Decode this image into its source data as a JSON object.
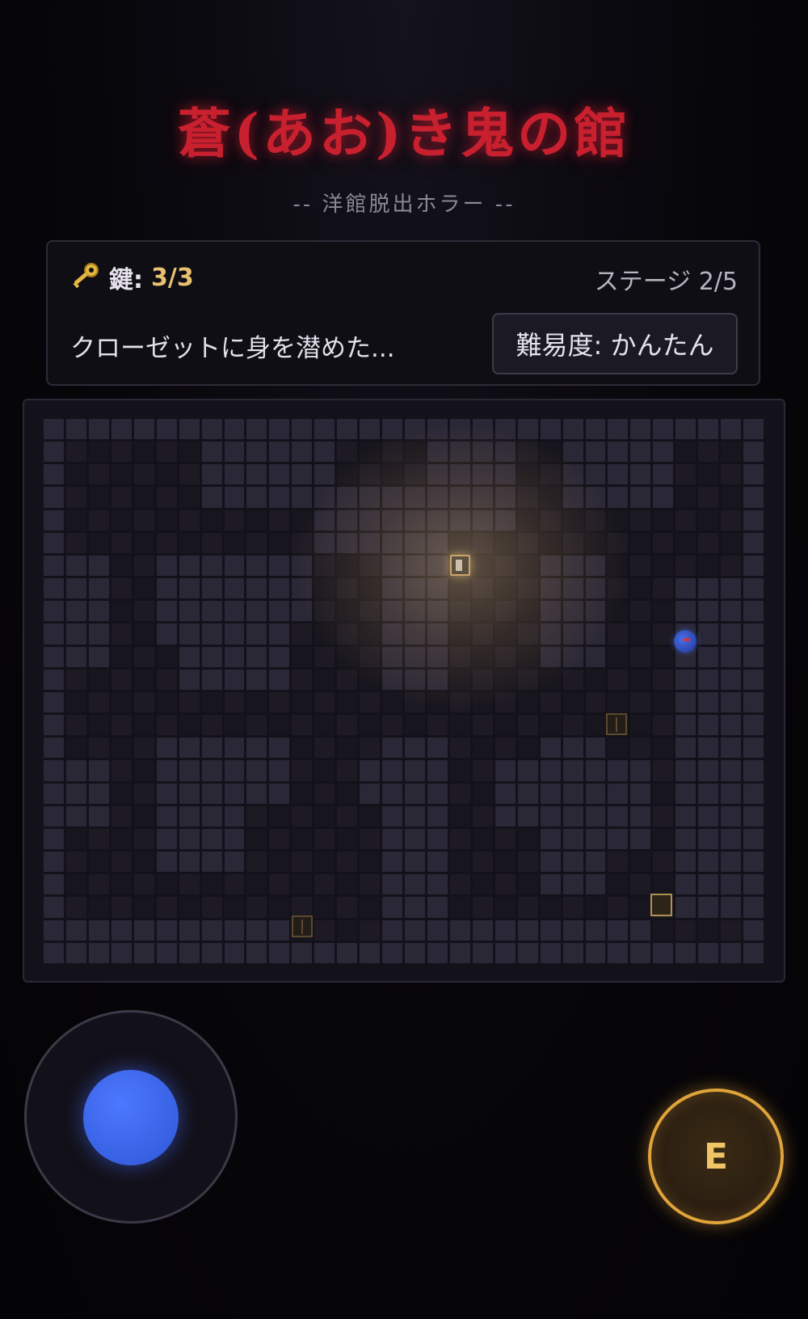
{
  "header": {
    "title": "蒼(あお)き鬼の館",
    "subtitle": "-- 洋館脱出ホラー --"
  },
  "status": {
    "keys_label": "鍵:",
    "keys_count": "3/3",
    "stage": "ステージ 2/5",
    "message": "クローゼットに身を潜めた...",
    "difficulty": "難易度: かんたん"
  },
  "controls": {
    "action_label": "E"
  },
  "colors": {
    "title": "#c8202e",
    "key_count": "#e8c170",
    "joystick": "#3a66f0",
    "action_ring": "#e0a53a"
  },
  "icons": {
    "keys": "key-icon",
    "ghost": "blue-oni-icon",
    "player": "player-icon",
    "closet": "closet-icon",
    "exit": "exit-door-icon"
  }
}
